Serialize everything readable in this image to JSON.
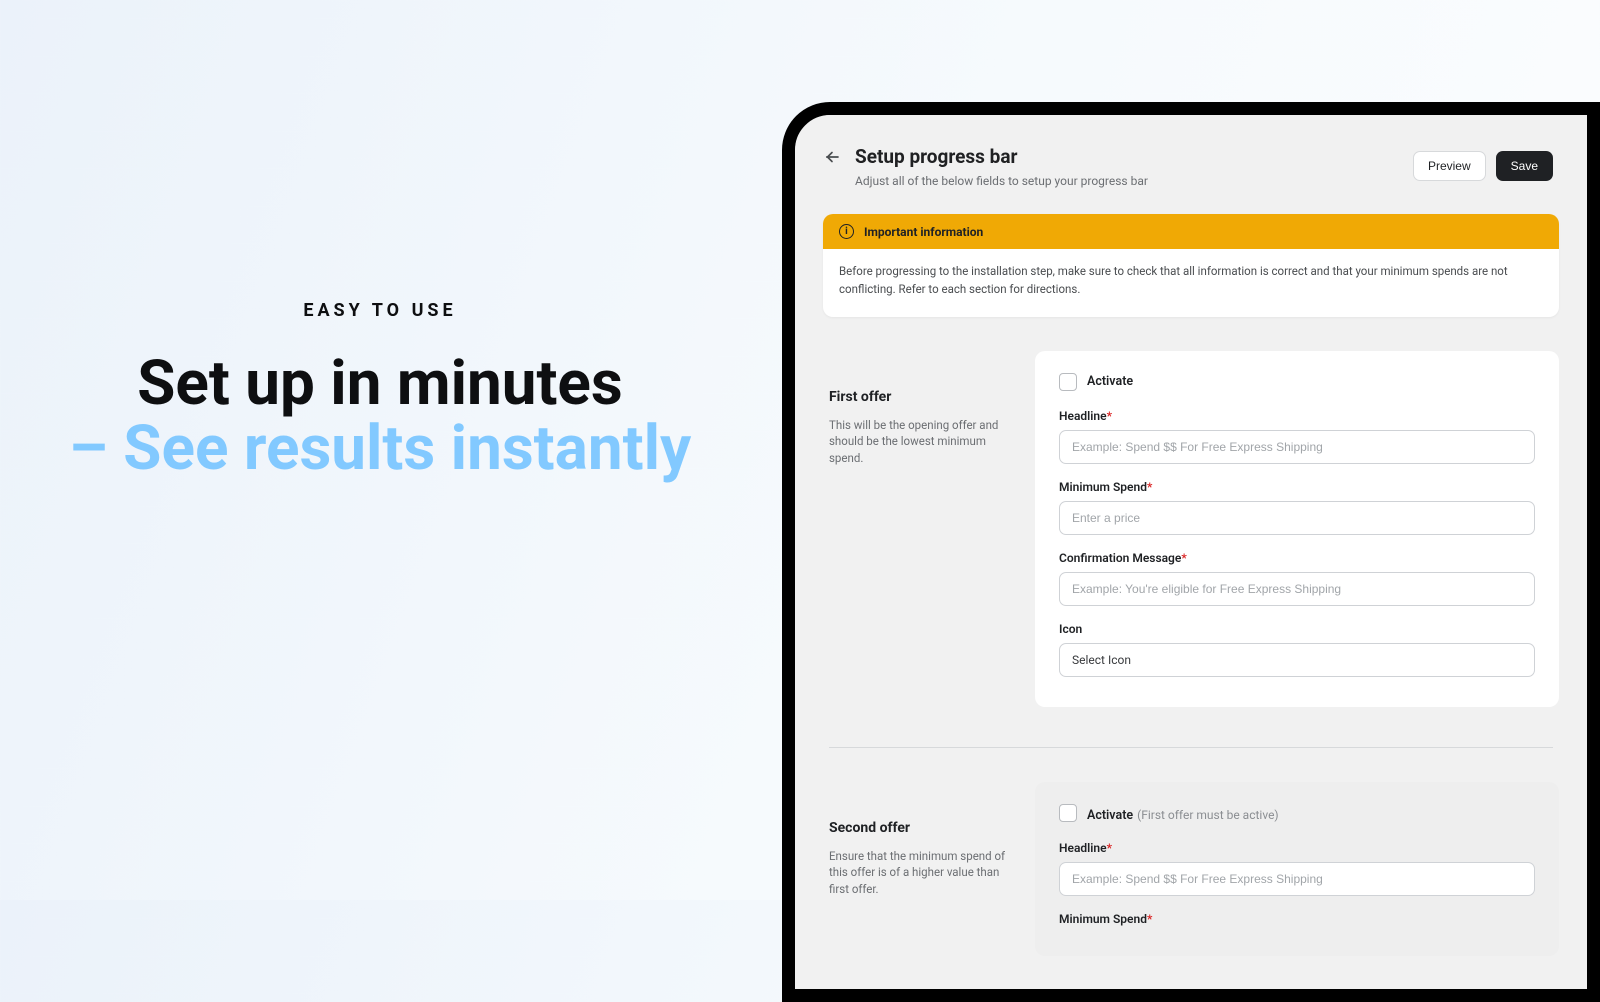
{
  "hero": {
    "eyebrow": "EASY TO USE",
    "headline": "Set up in minutes",
    "subhead": "– See results instantly"
  },
  "app": {
    "title": "Setup progress bar",
    "subtitle": "Adjust all of the below fields to setup your progress bar",
    "actions": {
      "preview": "Preview",
      "save": "Save"
    },
    "notice": {
      "heading": "Important information",
      "body": "Before progressing to the installation step, make sure to check that all information is correct and that your minimum spends are not conflicting. Refer to each section for directions."
    },
    "offer1": {
      "title": "First offer",
      "desc": "This will be the opening offer and should be the lowest minimum spend.",
      "activate": "Activate",
      "fields": {
        "headline_label": "Headline",
        "headline_ph": "Example: Spend $$ For Free Express Shipping",
        "minspend_label": "Minimum Spend",
        "minspend_ph": "Enter a price",
        "confirm_label": "Confirmation Message",
        "confirm_ph": "Example: You're eligible for Free Express Shipping",
        "icon_label": "Icon",
        "icon_value": "Select Icon"
      }
    },
    "offer2": {
      "title": "Second offer",
      "desc": "Ensure that the minimum spend of this offer is of a higher value than first offer.",
      "activate": "Activate",
      "activate_note": "(First offer must be active)",
      "fields": {
        "headline_label": "Headline",
        "headline_ph": "Example: Spend $$ For Free Express Shipping",
        "minspend_label": "Minimum Spend"
      }
    }
  }
}
